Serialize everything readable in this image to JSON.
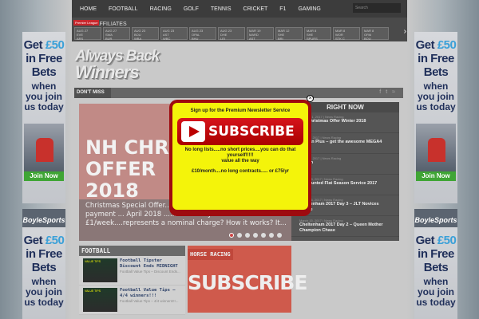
{
  "nav": {
    "items": [
      "HOME",
      "FOOTBALL",
      "RACING",
      "GOLF",
      "TENNIS",
      "CRICKET",
      "F1",
      "GAMING"
    ],
    "search_placeholder": "Search"
  },
  "scores": {
    "league_label": "Premier League",
    "bets_label": "BETS  AFFILIATES",
    "tiles": [
      {
        "date": "AUG 27",
        "home": "EVE",
        "away": "ARS"
      },
      {
        "date": "AUG 27",
        "home": "SWA",
        "away": "BUR"
      },
      {
        "date": "AUG 23",
        "home": "BOU",
        "away": "WBA"
      },
      {
        "date": "AUG 23",
        "home": "AST",
        "away": "WBC"
      },
      {
        "date": "AUG 23",
        "home": "OPAL",
        "away": "BHU"
      },
      {
        "date": "AUG 23",
        "home": "DHE",
        "away": "LEI"
      },
      {
        "date": "MAR 19",
        "home": "MARD",
        "away": "AST"
      },
      {
        "date": "MAR 12",
        "home": "SHE",
        "away": "BRI"
      },
      {
        "date": "MAR 8",
        "home": "SHE",
        "away": "SPURS"
      },
      {
        "date": "MAR 8",
        "home": "WOR",
        "away": "STK C"
      },
      {
        "date": "MAR 8",
        "home": "OPAI",
        "away": "BOU"
      }
    ]
  },
  "logo": {
    "line1": "Always Back",
    "line2": "Winners"
  },
  "dont_miss": "DON'T MISS",
  "slider": {
    "title_lines": [
      "NH CHR",
      "OFFER",
      "2018"
    ],
    "description": "Christmas Special Offer....... Winter 2017/18 One off payment ... April 2018 ......AROUND JUST £1/week....represents a nominal charge? How it works? It..."
  },
  "right_now": {
    "heading": "RIGHT NOW",
    "items": [
      {
        "meta": "October 1, 2017 | News Racing",
        "title": "NH Christmas Offer Winter 2018"
      },
      {
        "meta": "June 06, 2017 | News Racing",
        "title": "BetFan Plus – get the awesome MEGA4 FREE"
      },
      {
        "meta": "June 06, 2017 | News Racing",
        "title": "Betfan"
      },
      {
        "meta": "March 18, 2017 | News Racing",
        "title": "Discounted Flat Season Service 2017"
      },
      {
        "meta": "March 16, 2017 | News Racing",
        "title": "Cheltenham 2017 Day 3 – JLT Novices Chase"
      },
      {
        "meta": "March 15, 2017 | News Racing",
        "title": "Cheltenham 2017 Day 2 – Queen Mother Champion Chase"
      }
    ]
  },
  "football": {
    "heading": "FOOTBALL",
    "items": [
      {
        "thumb": "VALUE TIPS",
        "title": "Football Tipster Discount Ends MIDNIGHT",
        "excerpt": "Football Value Tips – Discount Ends..."
      },
      {
        "thumb": "VALUE TIPS",
        "title": "Football Value Tips – 4/4 winners!!!",
        "excerpt": "Football Value Tips – 4/4 winners!!!..."
      }
    ]
  },
  "horse_racing": {
    "heading": "HORSE RACING",
    "banner": "SUBSCRIBE"
  },
  "popup": {
    "heading": "Sign up for the Premium Newsletter Service",
    "button": "SUBSCRIBE",
    "line1": "No long lists.....no short prices....you can do that yourself!!!!!",
    "line2": "value all the way",
    "line3": "£10/month....no long contracts..... or £75/yr"
  },
  "ads": {
    "text1": "Get",
    "amount": "£50",
    "text2": "in Free Bets",
    "text3": "when you join us today",
    "join": "Join Now",
    "brand": "BoyleSports"
  }
}
